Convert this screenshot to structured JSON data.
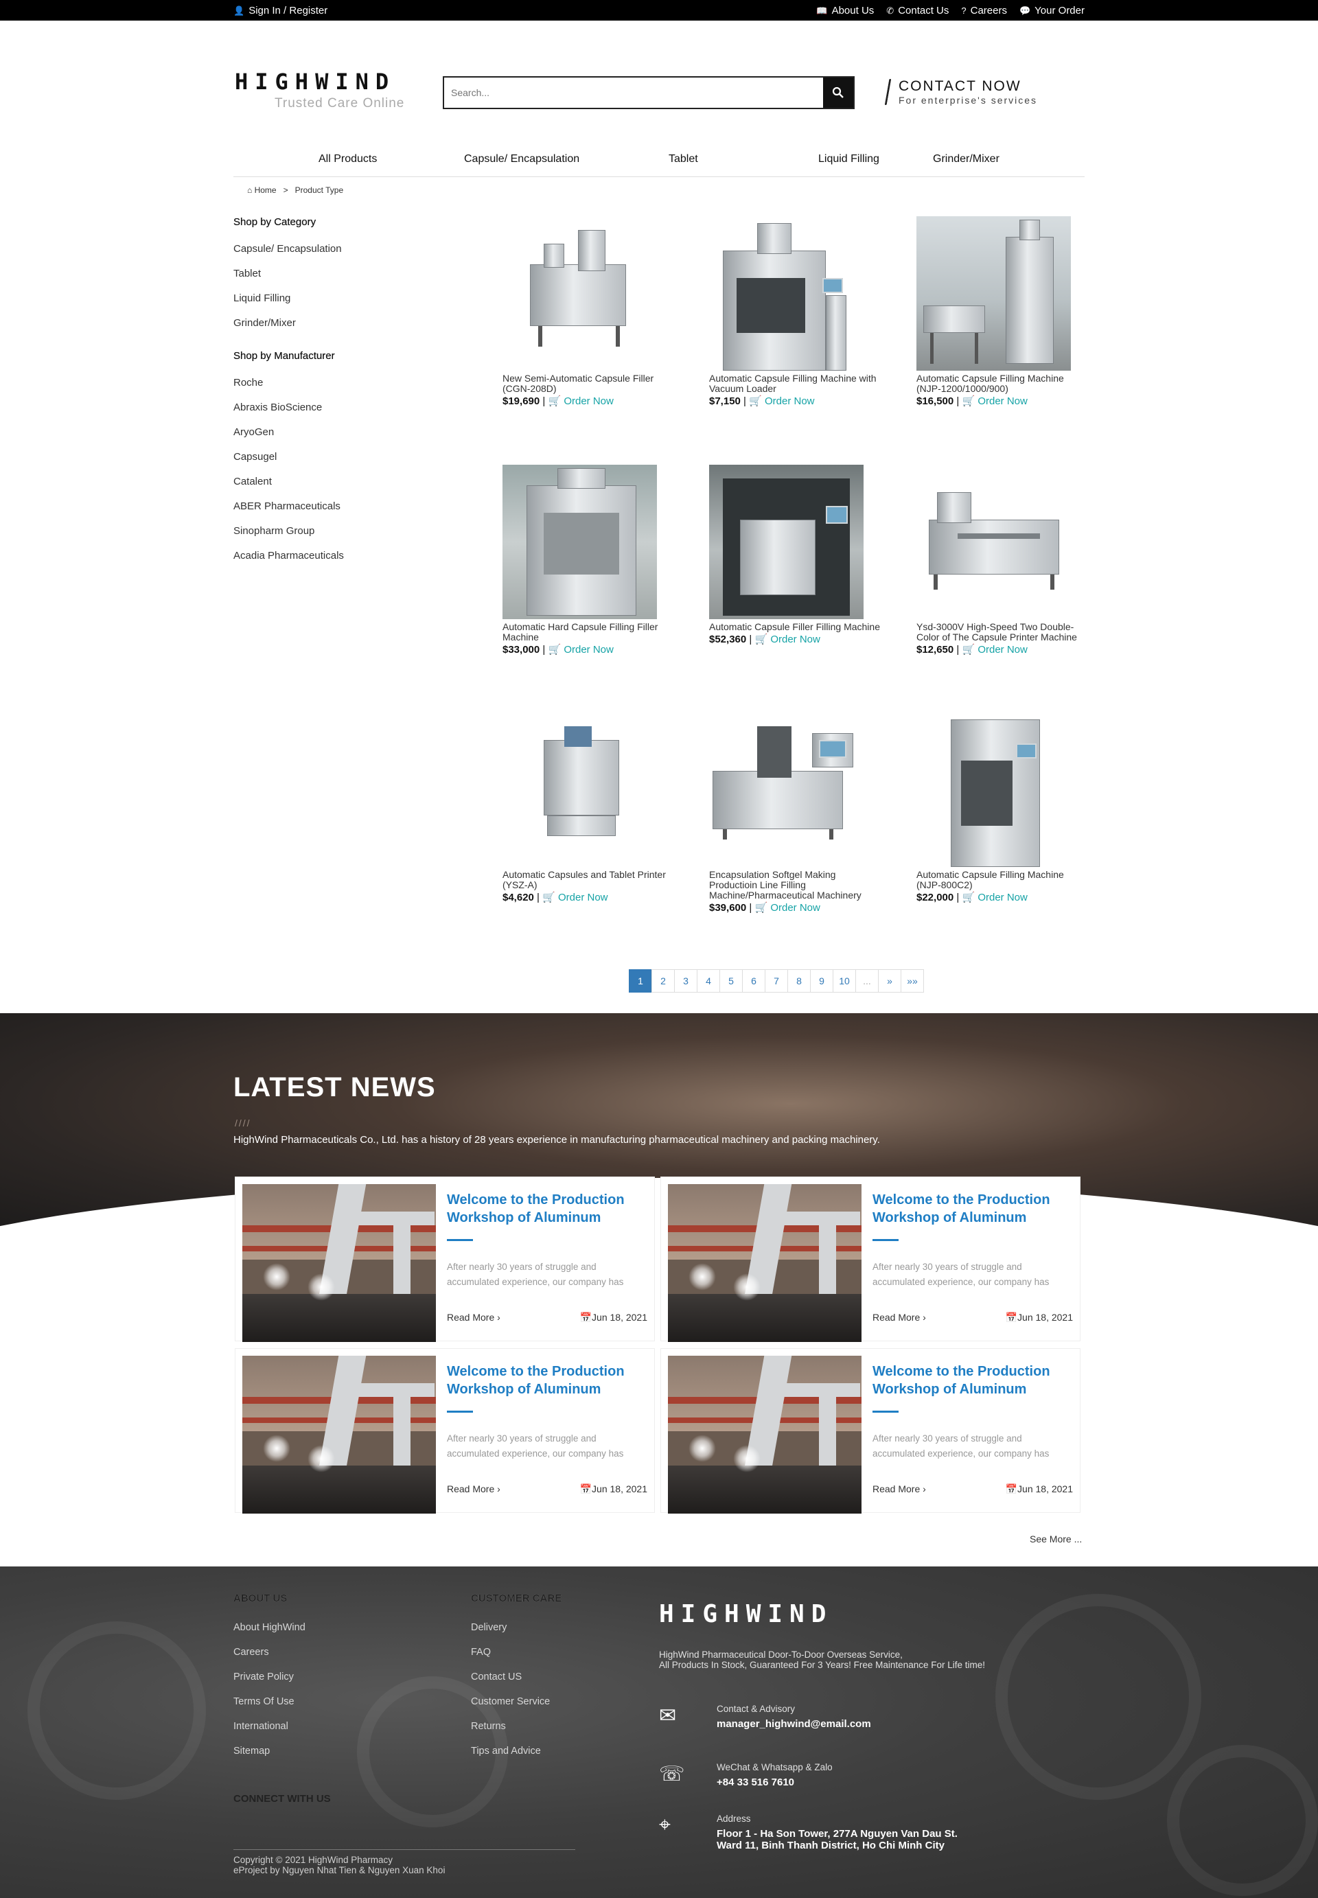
{
  "topbar": {
    "signin": "Sign In / Register",
    "links": [
      "About Us",
      "Contact Us",
      "Careers",
      "Your Order"
    ]
  },
  "header": {
    "logo": "HIGHWIND",
    "tagline": "Trusted Care Online",
    "search_placeholder": "Search...",
    "contact_title": "CONTACT NOW",
    "contact_sub": "For enterprise's services"
  },
  "nav": [
    "All Products",
    "Capsule/ Encapsulation",
    "Tablet",
    "Liquid Filling",
    "Grinder/Mixer"
  ],
  "breadcrumb": {
    "home": "Home",
    "sep": ">",
    "current": "Product Type"
  },
  "sidebar": {
    "category_title": "Shop by Category",
    "categories": [
      "Capsule/ Encapsulation",
      "Tablet",
      "Liquid Filling",
      "Grinder/Mixer"
    ],
    "manufacturer_title": "Shop by Manufacturer",
    "manufacturers": [
      "Roche",
      "Abraxis BioScience",
      "AryoGen",
      "Capsugel",
      "Catalent",
      "ABER Pharmaceuticals",
      "Sinopharm Group",
      "Acadia Pharmaceuticals"
    ]
  },
  "products": [
    {
      "name": "New Semi-Automatic Capsule Filler (CGN-208D)",
      "price": "$19,690",
      "order": "Order Now"
    },
    {
      "name": "Automatic Capsule Filling Machine with Vacuum Loader",
      "price": "$7,150",
      "order": "Order Now"
    },
    {
      "name": "Automatic Capsule Filling Machine (NJP-1200/1000/900)",
      "price": "$16,500",
      "order": "Order Now"
    },
    {
      "name": "Automatic Hard Capsule Filling Filler Machine",
      "price": "$33,000",
      "order": "Order Now"
    },
    {
      "name": "Automatic Capsule Filler Filling Machine",
      "price": "$52,360",
      "order": "Order Now"
    },
    {
      "name": "Ysd-3000V High-Speed Two Double-Color of The Capsule Printer Machine",
      "price": "$12,650",
      "order": "Order Now"
    },
    {
      "name": "Automatic Capsules and Tablet Printer (YSZ-A)",
      "price": "$4,620",
      "order": "Order Now"
    },
    {
      "name": "Encapsulation Softgel Making Productioin Line Filling Machine/Pharmaceutical Machinery",
      "price": "$39,600",
      "order": "Order Now"
    },
    {
      "name": "Automatic Capsule Filling Machine (NJP-800C2)",
      "price": "$22,000",
      "order": "Order Now"
    }
  ],
  "pagination": [
    "1",
    "2",
    "3",
    "4",
    "5",
    "6",
    "7",
    "8",
    "9",
    "10",
    "...",
    "»",
    "»»"
  ],
  "news": {
    "title": "LATEST NEWS",
    "dashes": "////",
    "description": "HighWind Pharmaceuticals Co., Ltd. has a history of 28 years experience in manufacturing pharmaceutical machinery and packing machinery.",
    "cards": [
      {
        "title": "Welcome to the Production Workshop of Aluminum",
        "excerpt": "After nearly 30 years of struggle and accumulated experience, our company has",
        "read_more": "Read More",
        "date": "Jun 18, 2021"
      },
      {
        "title": "Welcome to the Production Workshop of Aluminum",
        "excerpt": "After nearly 30 years of struggle and accumulated experience, our company has",
        "read_more": "Read More",
        "date": "Jun 18, 2021"
      },
      {
        "title": "Welcome to the Production Workshop of Aluminum",
        "excerpt": "After nearly 30 years of struggle and accumulated experience, our company has",
        "read_more": "Read More",
        "date": "Jun 18, 2021"
      },
      {
        "title": "Welcome to the Production Workshop of Aluminum",
        "excerpt": "After nearly 30 years of struggle and accumulated experience, our company has",
        "read_more": "Read More",
        "date": "Jun 18, 2021"
      }
    ],
    "see_more": "See More ..."
  },
  "footer": {
    "about_title": "ABOUT US",
    "about_links": [
      "About HighWind",
      "Careers",
      "Private Policy",
      "Terms Of Use",
      "International",
      "Sitemap"
    ],
    "care_title": "CUSTOMER CARE",
    "care_links": [
      "Delivery",
      "FAQ",
      "Contact US",
      "Customer Service",
      "Returns",
      "Tips and Advice"
    ],
    "brand": "HIGHWIND",
    "slogan_1": "HighWind Pharmaceutical Door-To-Door Overseas Service,",
    "slogan_2": "All Products In Stock, Guaranteed For 3 Years! Free Maintenance For Life time!",
    "contact_label": "Contact & Advisory",
    "contact_value": "manager_highwind@email.com",
    "phone_label": "WeChat & Whatsapp & Zalo",
    "phone_value": "+84 33 516 7610",
    "address_label": "Address",
    "address_1": "Floor 1 - Ha Son Tower, 277A Nguyen Van Dau St.",
    "address_2": "Ward 11, Binh Thanh District, Ho Chi Minh City",
    "connect": "CONNECT WITH US",
    "copyright_1": "Copyright © 2021 HighWind Pharmacy",
    "copyright_2": "eProject by Nguyen Nhat Tien & Nguyen Xuan Khoi"
  },
  "colors": {
    "accent": "#1f7ec4",
    "order": "#16a3a6",
    "active_page": "#337ab7"
  }
}
